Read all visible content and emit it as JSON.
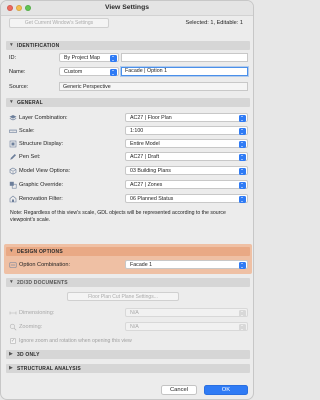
{
  "window": {
    "title": "View Settings",
    "get_current_button": "Get Current Window's Settings",
    "selection_info": "Selected: 1, Editable: 1"
  },
  "identification": {
    "header": "IDENTIFICATION",
    "id_label": "ID:",
    "id_popup": "By Project Map",
    "id_field": "",
    "name_label": "Name:",
    "name_popup": "Custom",
    "name_field": "Facade | Option 1",
    "source_label": "Source:",
    "source_value": "Generic Perspective"
  },
  "general": {
    "header": "GENERAL",
    "rows": [
      {
        "label": "Layer Combination:",
        "value": "AC27 | Floor Plan",
        "icon": "layers-icon"
      },
      {
        "label": "Scale:",
        "value": "1:100",
        "icon": "scale-icon"
      },
      {
        "label": "Structure Display:",
        "value": "Entire Model",
        "icon": "structure-icon"
      },
      {
        "label": "Pen Set:",
        "value": "AC27 | Draft",
        "icon": "pen-icon"
      },
      {
        "label": "Model View Options:",
        "value": "03 Building Plans",
        "icon": "model-view-icon"
      },
      {
        "label": "Graphic Override:",
        "value": "AC27 | Zones",
        "icon": "graphic-override-icon"
      },
      {
        "label": "Renovation Filter:",
        "value": "06 Planned Status",
        "icon": "renovation-icon"
      }
    ],
    "note": "Note: Regardless of this view's scale, GDL objects will be represented according to the source viewpoint's scale."
  },
  "design_options": {
    "header": "DESIGN OPTIONS",
    "label": "Option Combination:",
    "value": "Facade 1",
    "icon": "option-combination-icon",
    "highlight_color": "#efc0a4"
  },
  "docs_2d3d": {
    "header": "2D/3D DOCUMENTS",
    "floor_plan_button": "Floor Plan Cut Plane Settings...",
    "dimensioning_label": "Dimensioning:",
    "dimensioning_value": "N/A",
    "zooming_label": "Zooming:",
    "zooming_value": "N/A",
    "ignore_label": "Ignore zoom and rotation when opening this view"
  },
  "only_3d": {
    "header": "3D ONLY"
  },
  "structural": {
    "header": "STRUCTURAL ANALYSIS"
  },
  "footer": {
    "cancel": "Cancel",
    "ok": "OK"
  },
  "colors": {
    "accent": "#2f7bf5",
    "section": "#d6d6d6",
    "design_header": "#e9a985"
  }
}
